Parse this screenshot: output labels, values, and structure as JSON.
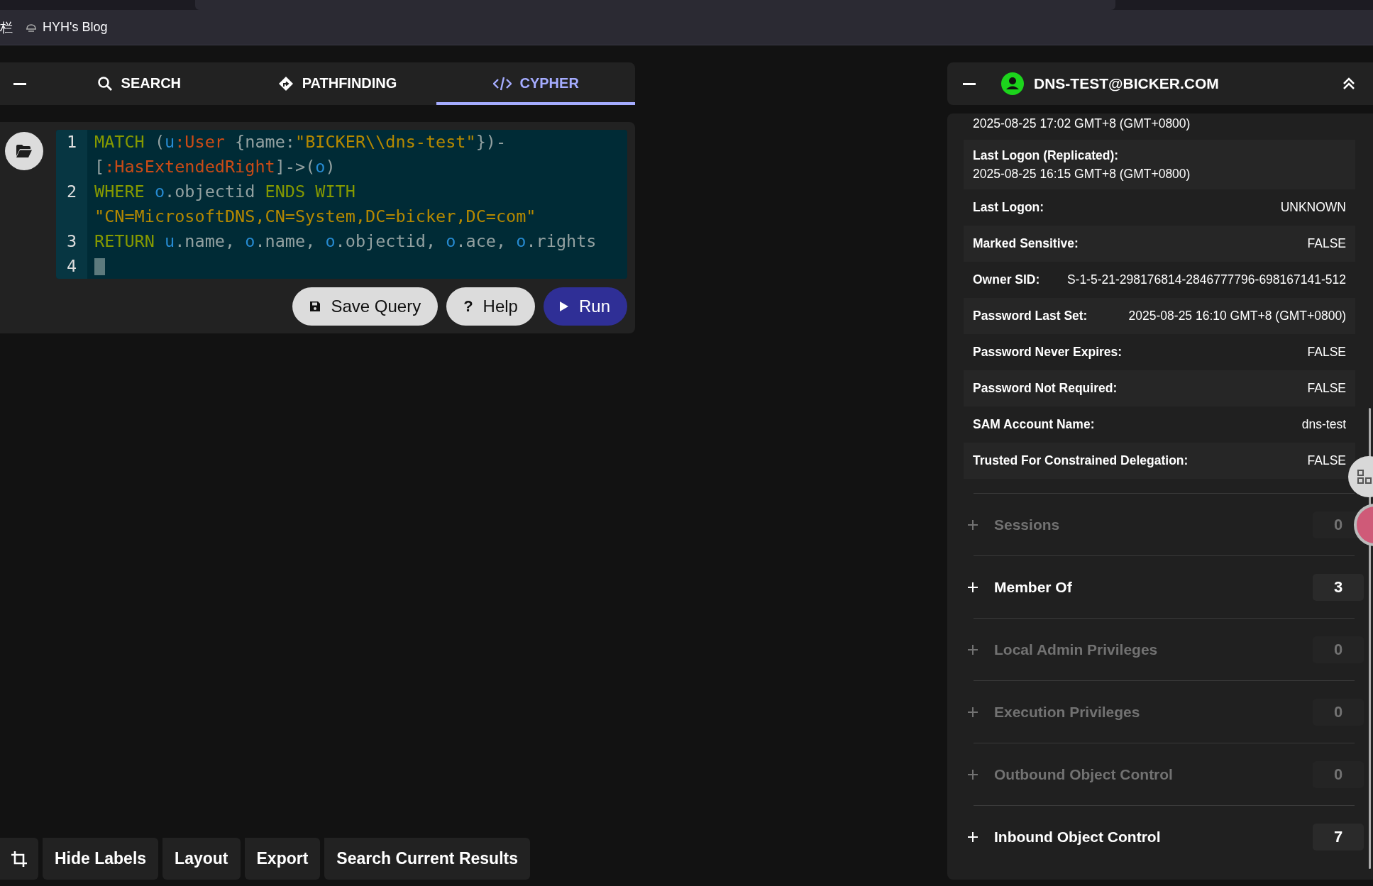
{
  "browser": {
    "bookmarks_bar_label": "栏",
    "bookmarks": [
      {
        "label": "HYH's Blog"
      }
    ]
  },
  "query_panel": {
    "tabs": [
      {
        "label": "SEARCH",
        "selected": false
      },
      {
        "label": "PATHFINDING",
        "selected": false
      },
      {
        "label": "CYPHER",
        "selected": true
      }
    ],
    "editor": {
      "lines": [
        {
          "number": "1",
          "rows": [
            "MATCH (u:User {name:\"BICKER\\\\dns-test\"})-",
            "[:HasExtendedRight]->(o)"
          ]
        },
        {
          "number": "2",
          "rows": [
            "WHERE o.objectid ENDS WITH",
            "\"CN=MicrosoftDNS,CN=System,DC=bicker,DC=com\""
          ]
        },
        {
          "number": "3",
          "rows": [
            "RETURN u.name, o.name, o.objectid, o.ace, o.rights"
          ]
        },
        {
          "number": "4",
          "cursor": true
        }
      ]
    },
    "buttons": [
      {
        "label": "Save Query",
        "kind": "save"
      },
      {
        "label": "Help",
        "kind": "help",
        "icon_text": "?"
      },
      {
        "label": "Run",
        "kind": "run"
      }
    ]
  },
  "toolbar": {
    "buttons": [
      "Hide Labels",
      "Layout",
      "Export",
      "Search Current Results"
    ]
  },
  "entity_panel": {
    "title": "DNS-TEST@BICKER.COM",
    "properties": [
      {
        "kind": "stacked",
        "value": "2025-08-25 17:02 GMT+8 (GMT+0800)"
      },
      {
        "kind": "stacked",
        "label": "Last Logon (Replicated):",
        "value": "2025-08-25 16:15 GMT+8 (GMT+0800)"
      },
      {
        "kind": "inline",
        "label": "Last Logon:",
        "value": "UNKNOWN"
      },
      {
        "kind": "inline",
        "label": "Marked Sensitive:",
        "value": "FALSE"
      },
      {
        "kind": "inline",
        "label": "Owner SID:",
        "value": "S-1-5-21-298176814-2846777796-698167141-512"
      },
      {
        "kind": "inline",
        "label": "Password Last Set:",
        "value": "2025-08-25 16:10 GMT+8 (GMT+0800)"
      },
      {
        "kind": "inline",
        "label": "Password Never Expires:",
        "value": "FALSE"
      },
      {
        "kind": "inline",
        "label": "Password Not Required:",
        "value": "FALSE"
      },
      {
        "kind": "inline",
        "label": "SAM Account Name:",
        "value": "dns-test"
      },
      {
        "kind": "inline",
        "label": "Trusted For Constrained Delegation:",
        "value": "FALSE"
      }
    ],
    "sections": [
      {
        "label": "Sessions",
        "count": "0",
        "disabled": true
      },
      {
        "label": "Member Of",
        "count": "3",
        "disabled": false
      },
      {
        "label": "Local Admin Privileges",
        "count": "0",
        "disabled": true
      },
      {
        "label": "Execution Privileges",
        "count": "0",
        "disabled": true
      },
      {
        "label": "Outbound Object Control",
        "count": "0",
        "disabled": true
      },
      {
        "label": "Inbound Object Control",
        "count": "7",
        "disabled": false
      }
    ]
  }
}
